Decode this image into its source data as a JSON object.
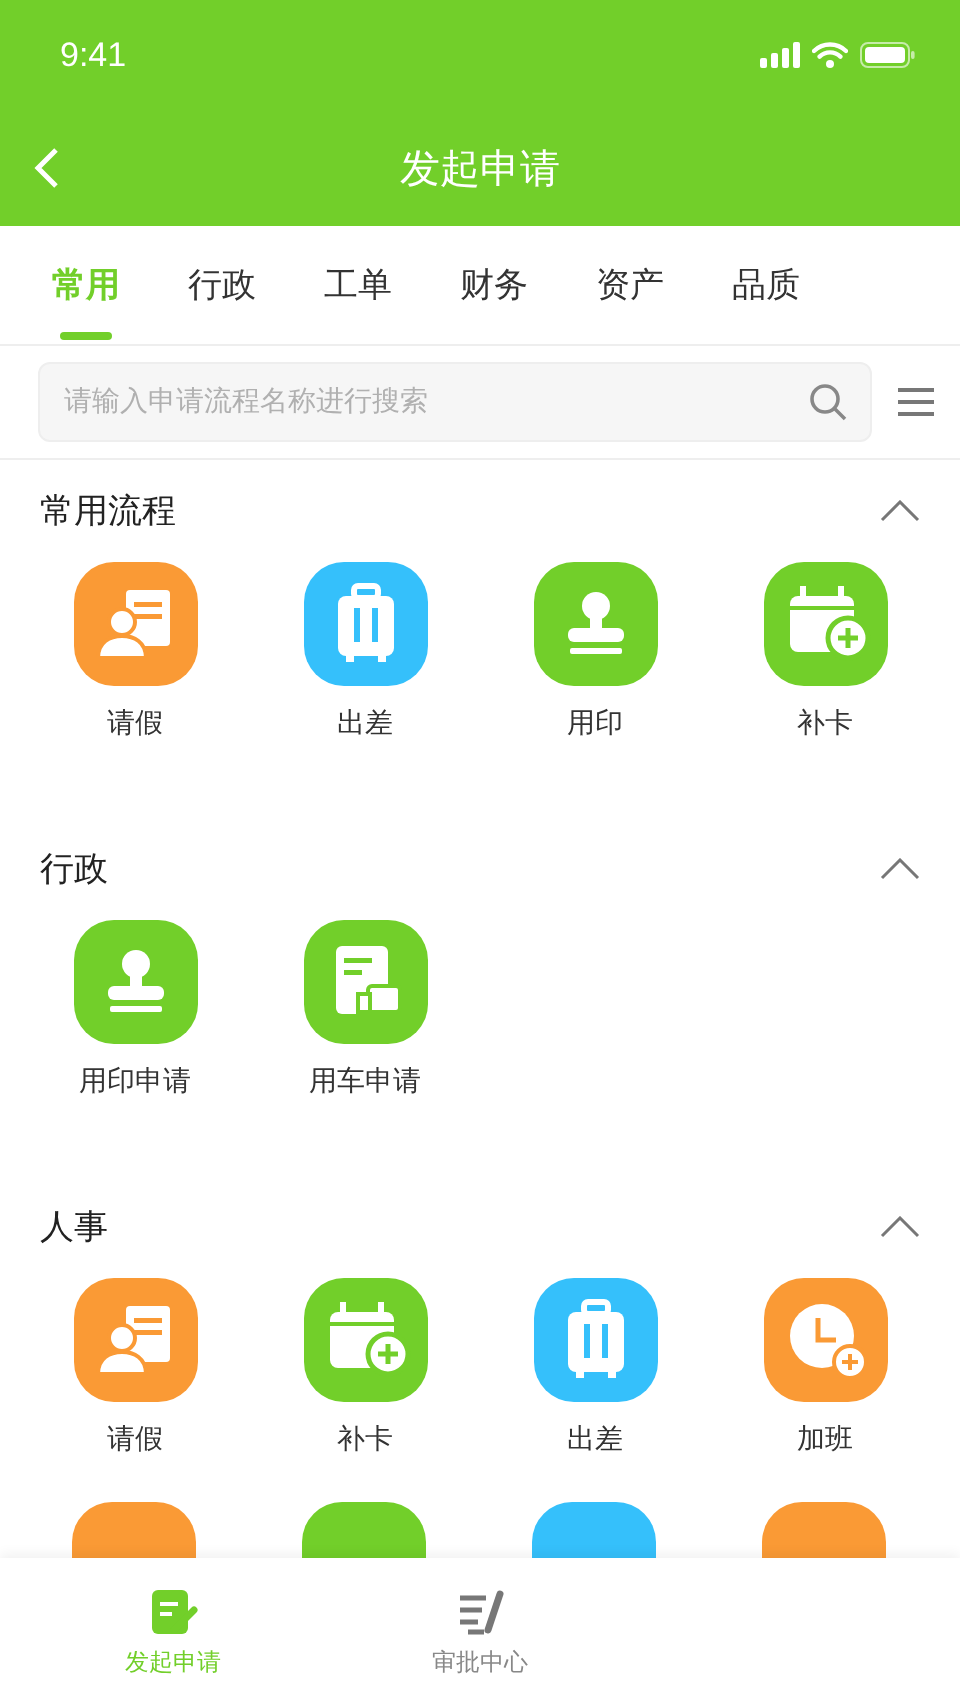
{
  "status_bar": {
    "time": "9:41"
  },
  "nav_bar": {
    "title": "发起申请"
  },
  "tabs": [
    {
      "label": "常用",
      "selected": true
    },
    {
      "label": "行政",
      "selected": false
    },
    {
      "label": "工单",
      "selected": false
    },
    {
      "label": "财务",
      "selected": false
    },
    {
      "label": "资产",
      "selected": false
    },
    {
      "label": "品质",
      "selected": false
    }
  ],
  "search": {
    "placeholder": "请输入申请流程名称进行搜索"
  },
  "sections": [
    {
      "title": "常用流程",
      "expanded": true,
      "items": [
        {
          "label": "请假",
          "kind": "person-doc",
          "color": "#fa9a35"
        },
        {
          "label": "出差",
          "kind": "suitcase",
          "color": "#35c0fb"
        },
        {
          "label": "用印",
          "kind": "stamp",
          "color": "#72cf2a"
        },
        {
          "label": "补卡",
          "kind": "calendar-plus",
          "color": "#72cf2a"
        }
      ]
    },
    {
      "title": "行政",
      "expanded": true,
      "items": [
        {
          "label": "用印申请",
          "kind": "stamp",
          "color": "#72cf2a"
        },
        {
          "label": "用车申请",
          "kind": "doc-truck",
          "color": "#72cf2a"
        }
      ]
    },
    {
      "title": "人事",
      "expanded": true,
      "items": [
        {
          "label": "请假",
          "kind": "person-doc",
          "color": "#fa9a35"
        },
        {
          "label": "补卡",
          "kind": "calendar-plus",
          "color": "#72cf2a"
        },
        {
          "label": "出差",
          "kind": "suitcase",
          "color": "#35c0fb"
        },
        {
          "label": "加班",
          "kind": "clock-plus",
          "color": "#fa9a35"
        }
      ]
    }
  ],
  "partial_row": [
    {
      "color": "#fa9a35"
    },
    {
      "color": "#72cf2a"
    },
    {
      "color": "#35c0fb"
    },
    {
      "color": "#fa9a35"
    }
  ],
  "bottom_tabs": [
    {
      "label": "发起申请",
      "kind": "compose",
      "selected": true
    },
    {
      "label": "审批中心",
      "kind": "list-pen",
      "selected": false
    }
  ]
}
